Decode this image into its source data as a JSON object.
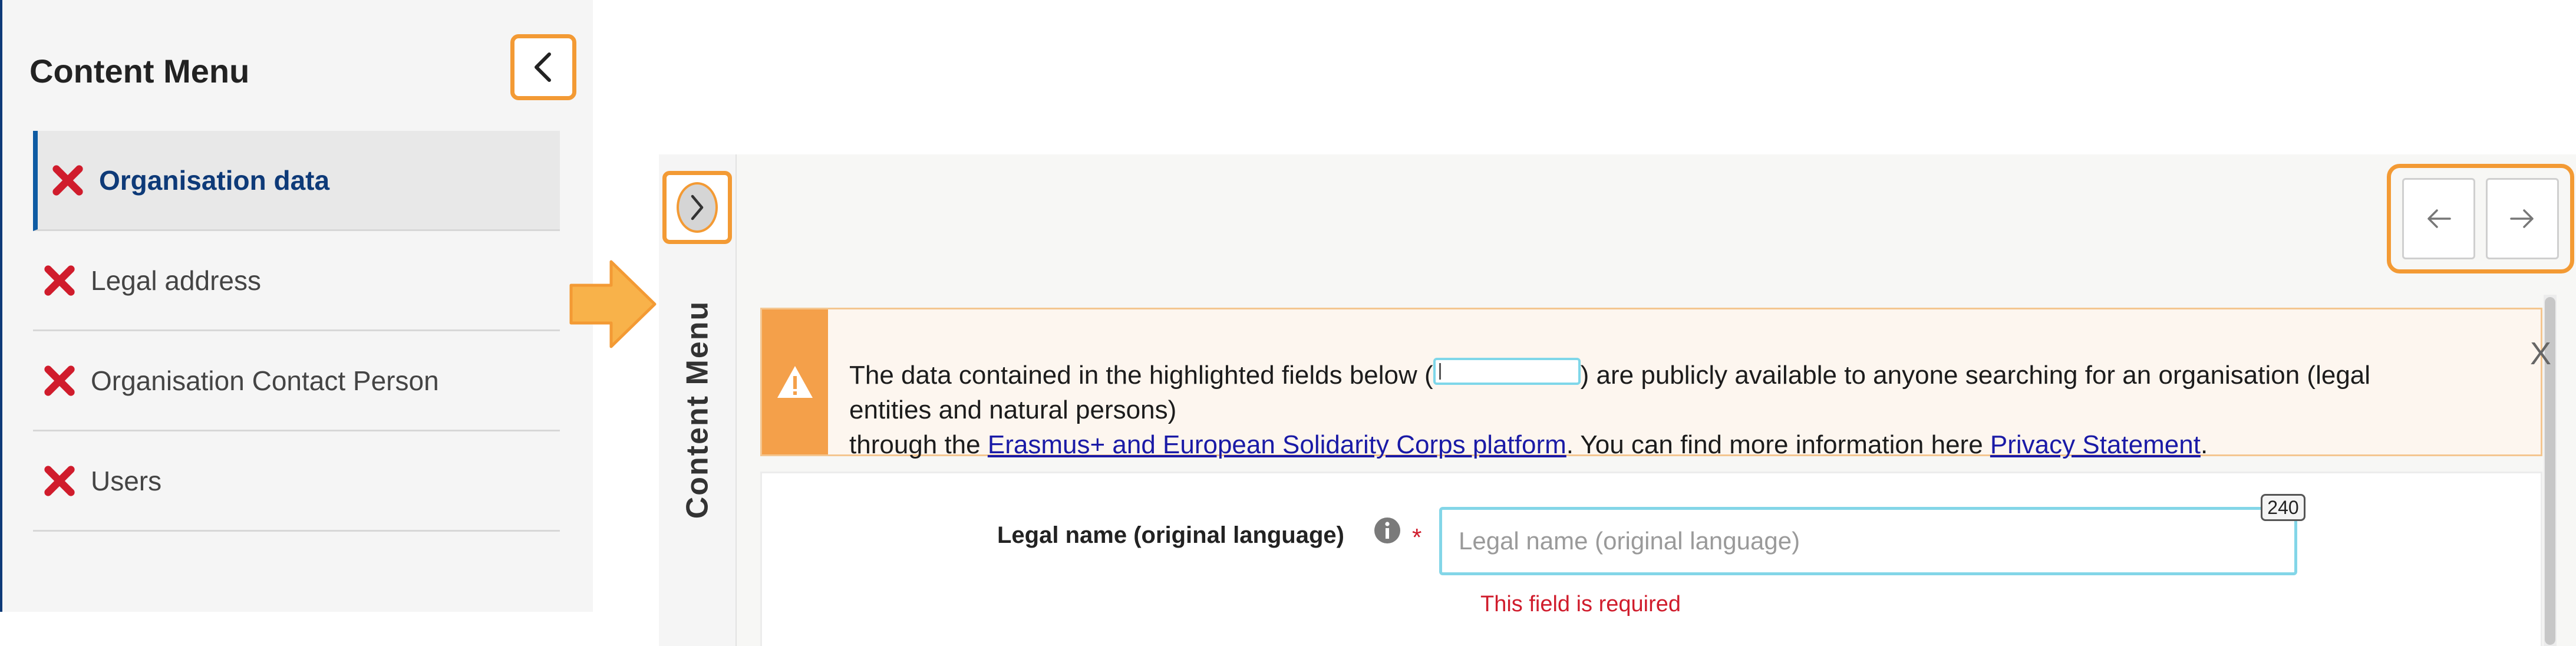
{
  "menu": {
    "title": "Content Menu",
    "items": [
      {
        "label": "Organisation data",
        "active": true,
        "status_icon": "red-x-icon"
      },
      {
        "label": "Legal address",
        "active": false,
        "status_icon": "red-x-icon"
      },
      {
        "label": "Organisation Contact Person",
        "active": false,
        "status_icon": "red-x-icon"
      },
      {
        "label": "Users",
        "active": false,
        "status_icon": "red-x-icon"
      }
    ]
  },
  "collapsed_menu": {
    "title": "Content Menu"
  },
  "notice": {
    "text_before_box": "The data contained in the highlighted fields below (",
    "text_after_box": ") are publicly available to anyone searching for an organisation (legal entities and natural persons)",
    "text_line2_start": "through the",
    "platform_link": "Erasmus+ and European Solidarity Corps platform",
    "text_line2_middle": ". You can find more information here",
    "privacy_link": "Privacy Statement",
    "text_end": ".",
    "close_label": "X"
  },
  "form": {
    "legal_name_label": "Legal name (original language)",
    "required_mark": "*",
    "legal_name_placeholder": "Legal name (original language)",
    "legal_name_value": "",
    "char_count": "240",
    "error_message": "This field is required"
  },
  "colors": {
    "highlight": "#f39a34",
    "brand_blue": "#0e3a78",
    "error_red": "#d01c2c",
    "warning_orange": "#f4a04a",
    "field_cyan": "#83d6e8"
  }
}
